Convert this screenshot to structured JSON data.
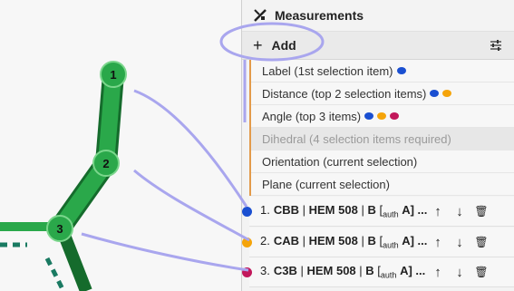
{
  "viewport": {
    "atoms": [
      {
        "label": "1"
      },
      {
        "label": "2"
      },
      {
        "label": "3"
      }
    ]
  },
  "panel": {
    "title": "Measurements",
    "header_icon": "measure-tools-icon",
    "add_label": "Add",
    "settings_icon": "sliders-icon",
    "menu": [
      {
        "label": "Label (1st selection item)",
        "dots": [
          "#1a4fd1"
        ],
        "disabled": false
      },
      {
        "label": "Distance (top 2 selection items)",
        "dots": [
          "#1a4fd1",
          "#f5a40a"
        ],
        "disabled": false
      },
      {
        "label": "Angle (top 3 items)",
        "dots": [
          "#1a4fd1",
          "#f5a40a",
          "#c2185b"
        ],
        "disabled": false
      },
      {
        "label": "Dihedral (4 selection items required)",
        "dots": [],
        "disabled": true
      },
      {
        "label": "Orientation (current selection)",
        "dots": [],
        "disabled": false
      },
      {
        "label": "Plane (current selection)",
        "dots": [],
        "disabled": false
      }
    ],
    "measurements": [
      {
        "num": "1.",
        "atom": "CBB",
        "res": "HEM 508",
        "chain": "B",
        "auth": "auth",
        "chain2": "A",
        "color": "#1a4fd1"
      },
      {
        "num": "2.",
        "atom": "CAB",
        "res": "HEM 508",
        "chain": "B",
        "auth": "auth",
        "chain2": "A",
        "color": "#f5a40a"
      },
      {
        "num": "3.",
        "atom": "C3B",
        "res": "HEM 508",
        "chain": "B",
        "auth": "auth",
        "chain2": "A",
        "color": "#c2185b"
      }
    ],
    "row_icons": [
      "arrow-up-icon",
      "arrow-down-icon",
      "trash-icon"
    ]
  },
  "colors": {
    "bond": "#2aa84a",
    "bond_dark": "#156b2c",
    "annotation": "#a9a6ee"
  }
}
